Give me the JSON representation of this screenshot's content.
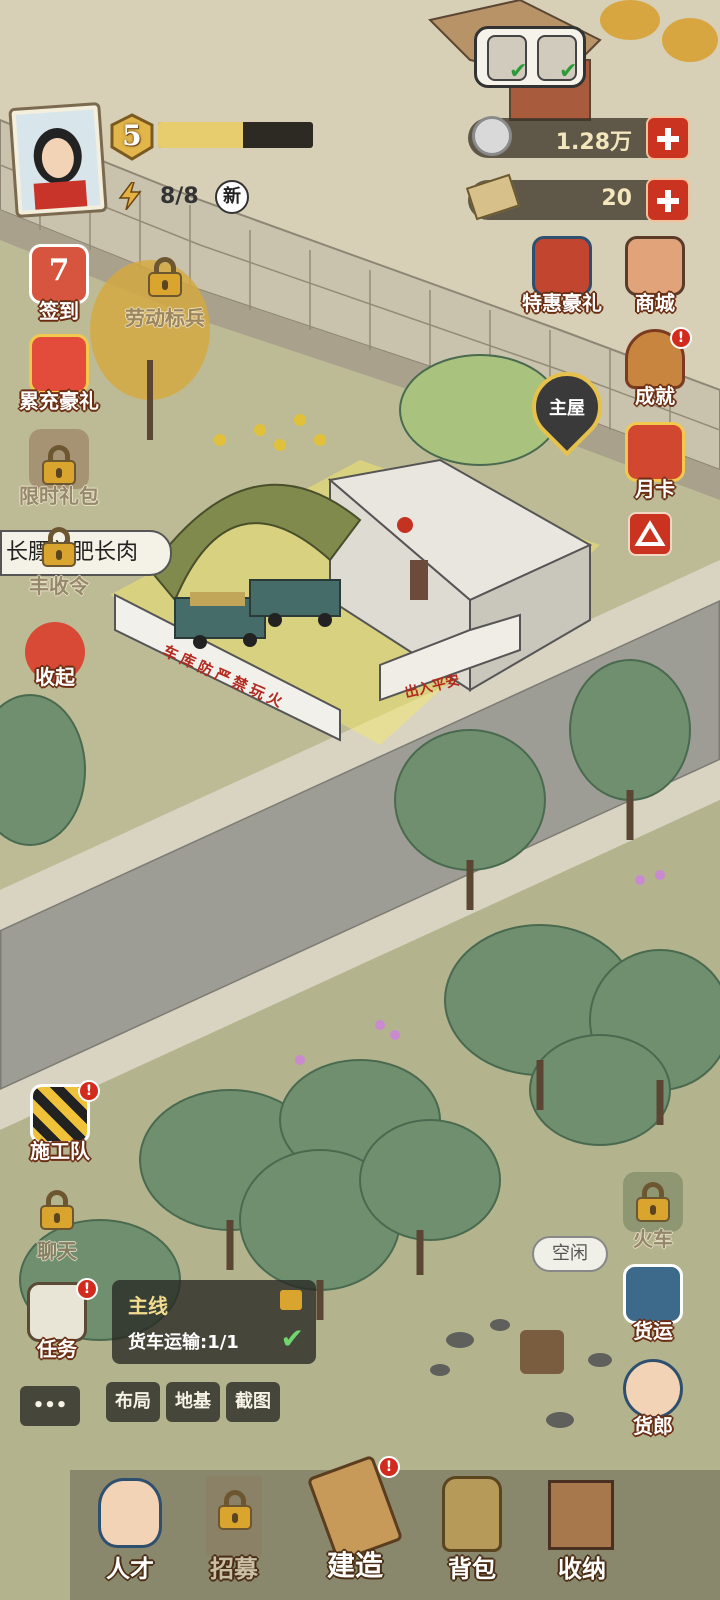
{
  "player": {
    "level": "5",
    "exp_progress": 0.55,
    "energy": "8/8",
    "energy_badge": "新"
  },
  "resources": {
    "coins": "1.28万",
    "tickets": "20"
  },
  "left_menu": [
    {
      "label": "签到",
      "calendar_day": "7",
      "locked": false
    },
    {
      "label": "劳动标兵",
      "locked": true
    },
    {
      "label": "累充豪礼",
      "locked": false
    },
    {
      "label": "限时礼包",
      "locked": true
    },
    {
      "label": "丰收令",
      "locked": true
    },
    {
      "label": "收起",
      "locked": false
    }
  ],
  "right_menu": [
    {
      "label": "特惠豪礼",
      "alert": false
    },
    {
      "label": "商城",
      "alert": false
    },
    {
      "label": "成就",
      "alert": true
    },
    {
      "label": "月卡",
      "alert": false
    }
  ],
  "scroll_tip": {
    "text": "长膘养肥长肉"
  },
  "building": {
    "name": "主屋",
    "wall_slogan": "车库防严禁玩火",
    "gate_sign": "出入平安"
  },
  "status_bubble": {
    "text": "空闲"
  },
  "left_bottom_menu": [
    {
      "label": "施工队",
      "alert": true,
      "locked": false
    },
    {
      "label": "聊天",
      "alert": false,
      "locked": true
    },
    {
      "label": "任务",
      "alert": true,
      "locked": false
    }
  ],
  "right_bottom_menu": [
    {
      "label": "火车",
      "locked": true
    },
    {
      "label": "货运",
      "locked": false
    },
    {
      "label": "货郎",
      "locked": false
    }
  ],
  "quest": {
    "title": "主线",
    "task": "货车运输:1/1"
  },
  "tools": {
    "more": "•••",
    "layout": "布局",
    "foundation": "地基",
    "screenshot": "截图"
  },
  "bottom_nav": [
    {
      "label": "人才",
      "locked": false,
      "alert": false
    },
    {
      "label": "招募",
      "locked": true,
      "alert": false
    },
    {
      "label": "建造",
      "locked": false,
      "alert": true
    },
    {
      "label": "背包",
      "locked": false,
      "alert": false
    },
    {
      "label": "收纳",
      "locked": false,
      "alert": false
    }
  ],
  "colors": {
    "grass": "#b9b78f",
    "road": "#9b9a92",
    "accent_red": "#c9331f",
    "highlight": "#f4e76a"
  }
}
